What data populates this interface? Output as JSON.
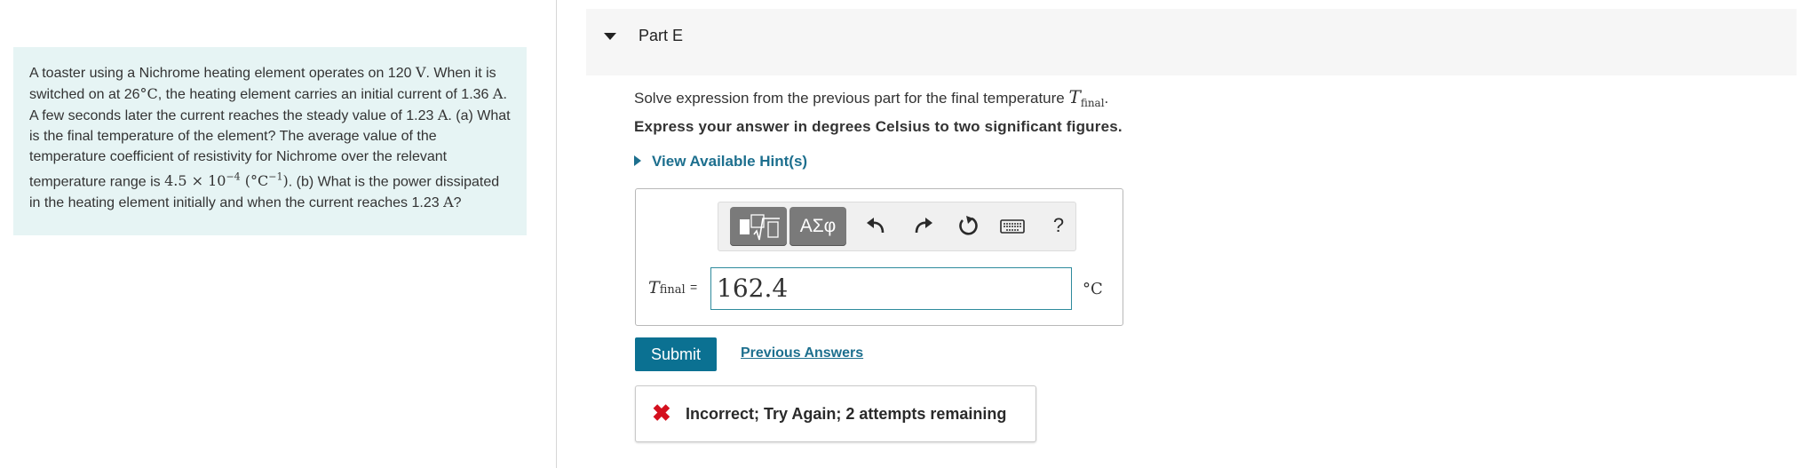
{
  "problem": {
    "t1": "A toaster using a Nichrome heating element operates on 120 ",
    "m1": "V",
    "t2": ". When it is switched on at 26",
    "m2": "°C",
    "t3": ", the heating element carries an initial current of 1.36 ",
    "m3": "A",
    "t4": ". A few seconds later the current reaches the steady value of 1.23 ",
    "m4": "A",
    "t5": ". (a) What is the final temperature of the element? The average value of the temperature coefficient of resistivity for Nichrome over the relevant temperature range is ",
    "m5": "4.5 × 10",
    "m5sup": "−4",
    "m6": " (°C",
    "m6sup": "−1",
    "m7": ")",
    "t6": ". (b) What is the power dissipated in the heating element initially and when the current reaches 1.23 ",
    "m8": "A",
    "t7": "?"
  },
  "part": {
    "title": "Part E"
  },
  "prompt": {
    "text": "Solve expression from the previous part for the final temperature ",
    "var": "T",
    "sub": "final",
    "end": "."
  },
  "instruction": "Express your answer in degrees Celsius to two significant figures.",
  "hints": {
    "label": "View Available Hint(s)"
  },
  "toolbar": {
    "symbols_label": "ΑΣφ",
    "undo_icon": "undo-icon",
    "redo_icon": "redo-icon",
    "reset_icon": "reset-icon",
    "keyboard_icon": "keyboard-icon",
    "help_label": "?"
  },
  "answer": {
    "var": "T",
    "sub": "final",
    "equals": "=",
    "value": "162.4",
    "unit": "°C"
  },
  "actions": {
    "submit_label": "Submit",
    "previous_answers_label": "Previous Answers"
  },
  "feedback": {
    "icon": "✖",
    "text": "Incorrect; Try Again; 2 attempts remaining",
    "color": "#d4101e"
  },
  "colors": {
    "accent": "#0b7192",
    "link": "#1d6f8e",
    "problem_bg": "#e6f4f4"
  }
}
